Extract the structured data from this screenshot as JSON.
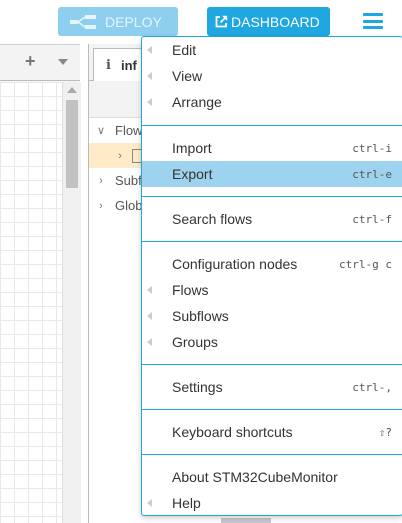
{
  "header": {
    "deploy_label": "DEPLOY",
    "dashboard_label": "DASHBOARD"
  },
  "workspace": {
    "add_tab": "+"
  },
  "sidebar": {
    "tab_icon": "i",
    "tab_label": "inf",
    "tree": [
      {
        "label": "Flow",
        "expanded": true
      },
      {
        "label": "",
        "expanded": false,
        "selected": true
      },
      {
        "label": "Subf",
        "expanded": false
      },
      {
        "label": "Glob",
        "expanded": false
      }
    ]
  },
  "menu": {
    "items": {
      "edit": {
        "label": "Edit"
      },
      "view": {
        "label": "View"
      },
      "arrange": {
        "label": "Arrange"
      },
      "import": {
        "label": "Import",
        "shortcut": "ctrl-i"
      },
      "export": {
        "label": "Export",
        "shortcut": "ctrl-e"
      },
      "search_flows": {
        "label": "Search flows",
        "shortcut": "ctrl-f"
      },
      "configuration_nodes": {
        "label": "Configuration nodes",
        "shortcut": "ctrl-g c"
      },
      "flows": {
        "label": "Flows"
      },
      "subflows": {
        "label": "Subflows"
      },
      "groups": {
        "label": "Groups"
      },
      "settings": {
        "label": "Settings",
        "shortcut": "ctrl-,"
      },
      "keyboard_shortcuts": {
        "label": "Keyboard shortcuts",
        "shortcut": "⇧?"
      },
      "about": {
        "label": "About STM32CubeMonitor"
      },
      "help": {
        "label": "Help"
      }
    }
  },
  "colors": {
    "accent": "#1ea7e1",
    "deploy_disabled": "#8ecff0",
    "menu_active": "#9dd3ee",
    "tree_selected": "#ffebc7"
  }
}
